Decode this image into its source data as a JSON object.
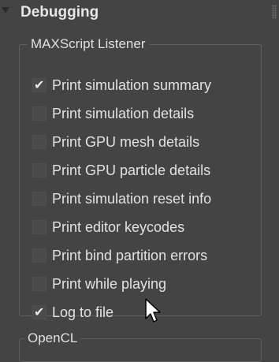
{
  "rollout": {
    "title": "Debugging"
  },
  "listener_group": {
    "legend": "MAXScript Listener",
    "options": [
      {
        "label": "Print simulation summary",
        "checked": true
      },
      {
        "label": "Print simulation details",
        "checked": false
      },
      {
        "label": "Print GPU mesh details",
        "checked": false
      },
      {
        "label": "Print GPU particle details",
        "checked": false
      },
      {
        "label": "Print simulation reset info",
        "checked": false
      },
      {
        "label": "Print editor keycodes",
        "checked": false
      },
      {
        "label": "Print bind partition errors",
        "checked": false
      },
      {
        "label": "Print while playing",
        "checked": false
      },
      {
        "label": "Log to file",
        "checked": true
      }
    ]
  },
  "opencl_group": {
    "legend": "OpenCL"
  },
  "icons": {
    "collapse": "collapse-arrow-icon",
    "grip": "grip-icon",
    "cursor": "mouse-cursor-icon",
    "check": "check-mark-icon"
  },
  "colors": {
    "background": "#444444",
    "text": "#e2e2e2",
    "checkbox": "#4a4a4a",
    "border": "#5f5f5f"
  }
}
